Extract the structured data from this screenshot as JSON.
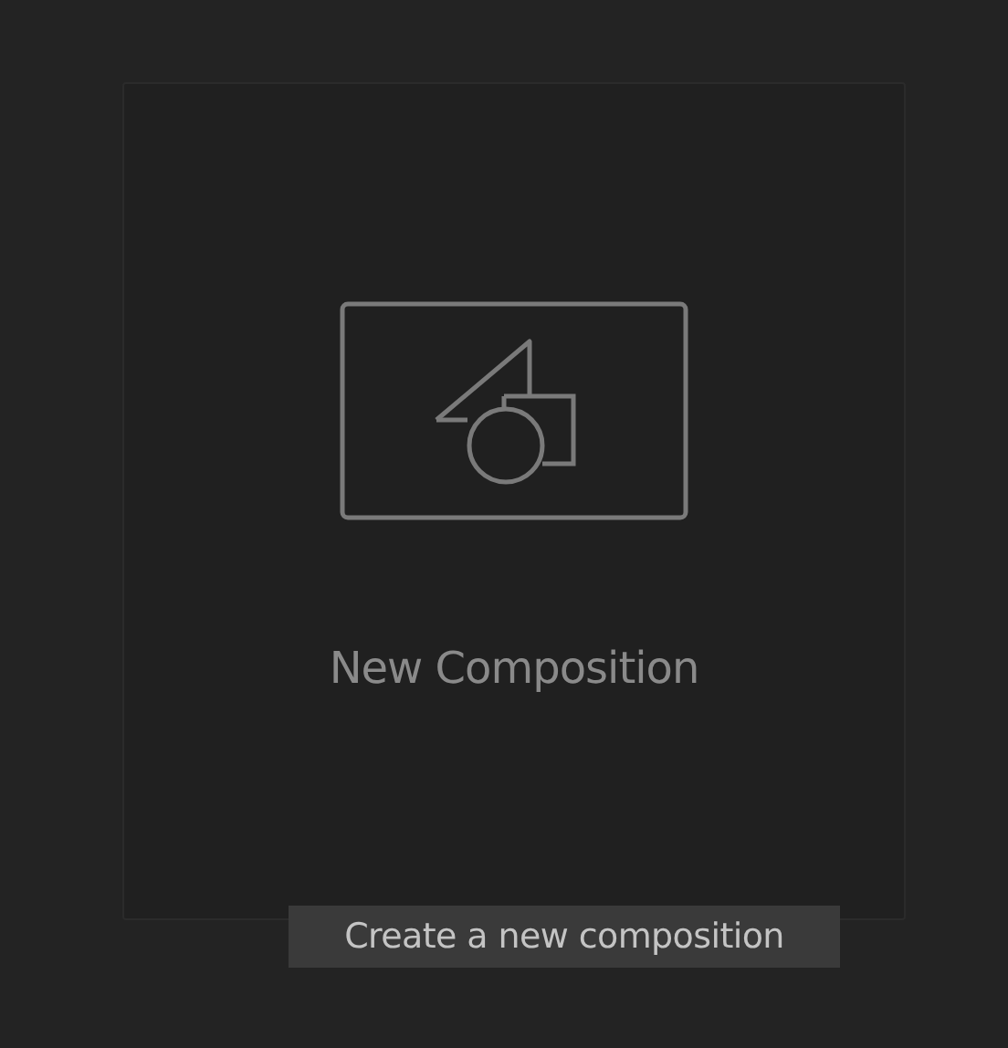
{
  "card": {
    "label": "New Composition"
  },
  "tooltip": {
    "text": "Create a new composition"
  }
}
